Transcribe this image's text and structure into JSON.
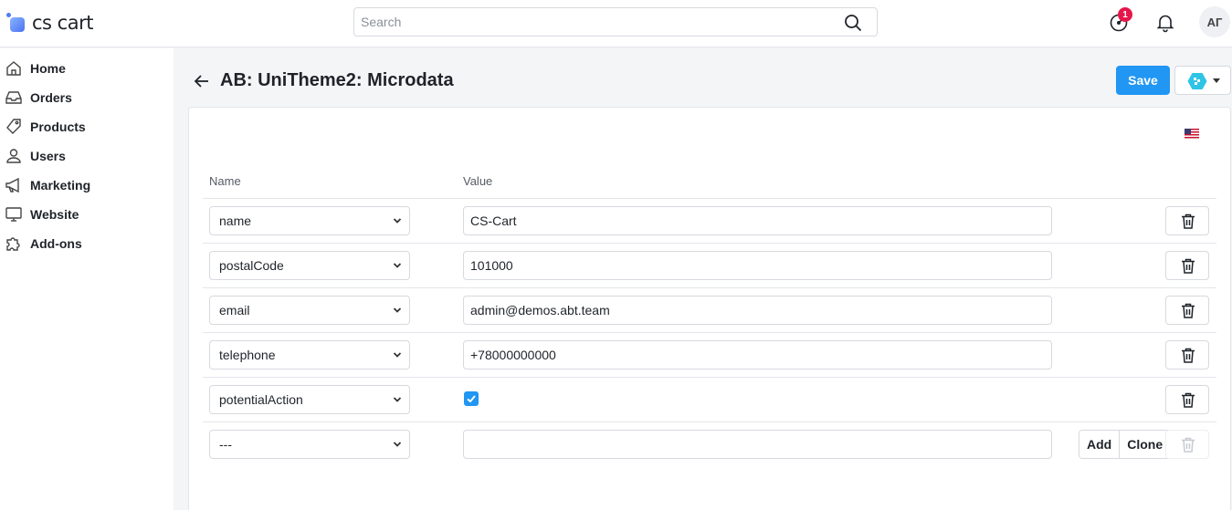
{
  "header": {
    "logo_text": "cs cart",
    "search_placeholder": "Search",
    "notification_count": "1",
    "avatar_initials": "АГ"
  },
  "sidebar": {
    "items": [
      {
        "label": "Home",
        "icon": "home-icon"
      },
      {
        "label": "Orders",
        "icon": "inbox-icon"
      },
      {
        "label": "Products",
        "icon": "tag-icon"
      },
      {
        "label": "Users",
        "icon": "user-icon"
      },
      {
        "label": "Marketing",
        "icon": "megaphone-icon"
      },
      {
        "label": "Website",
        "icon": "monitor-icon"
      },
      {
        "label": "Add-ons",
        "icon": "puzzle-icon"
      }
    ]
  },
  "page": {
    "title": "AB: UniTheme2: Microdata",
    "save_label": "Save",
    "language_flag": "us-flag-icon"
  },
  "table": {
    "columns": {
      "name": "Name",
      "value": "Value"
    },
    "rows": [
      {
        "name": "name",
        "value": "CS-Cart"
      },
      {
        "name": "postalCode",
        "value": "101000"
      },
      {
        "name": "email",
        "value": "admin@demos.abt.team"
      },
      {
        "name": "telephone",
        "value": "+78000000000"
      },
      {
        "name": "potentialAction",
        "checked": true
      }
    ],
    "new_row": {
      "name": "---",
      "value": ""
    },
    "add_label": "Add",
    "clone_label": "Clone"
  },
  "colors": {
    "accent": "#2196f3",
    "badge": "#e5174a"
  }
}
